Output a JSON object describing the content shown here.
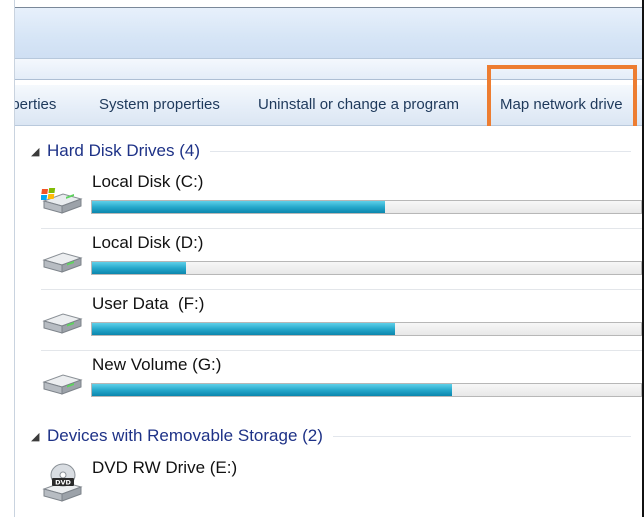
{
  "command_bar": {
    "items": [
      {
        "label": "operties"
      },
      {
        "label": "System properties"
      },
      {
        "label": "Uninstall or change a program"
      },
      {
        "label": "Map network drive"
      }
    ]
  },
  "groups": {
    "hard_disks": {
      "title": "Hard Disk Drives (4)",
      "drives": [
        {
          "label": "Local Disk (C:)",
          "used_fraction": 0.534,
          "icon": "windows-hard-drive-icon"
        },
        {
          "label": "Local Disk (D:)",
          "used_fraction": 0.172,
          "icon": "hard-drive-icon"
        },
        {
          "label": "User Data  (F:)",
          "used_fraction": 0.552,
          "icon": "hard-drive-icon"
        },
        {
          "label": "New Volume (G:)",
          "used_fraction": 0.656,
          "icon": "hard-drive-icon"
        }
      ]
    },
    "removable": {
      "title": "Devices with Removable Storage (2)",
      "drives": [
        {
          "label": "DVD RW Drive (E:)",
          "icon": "dvd-drive-icon"
        }
      ]
    }
  },
  "colors": {
    "highlight": "#ed7d31",
    "group_title": "#1e3287",
    "usage_fill": "#27a9cc"
  }
}
